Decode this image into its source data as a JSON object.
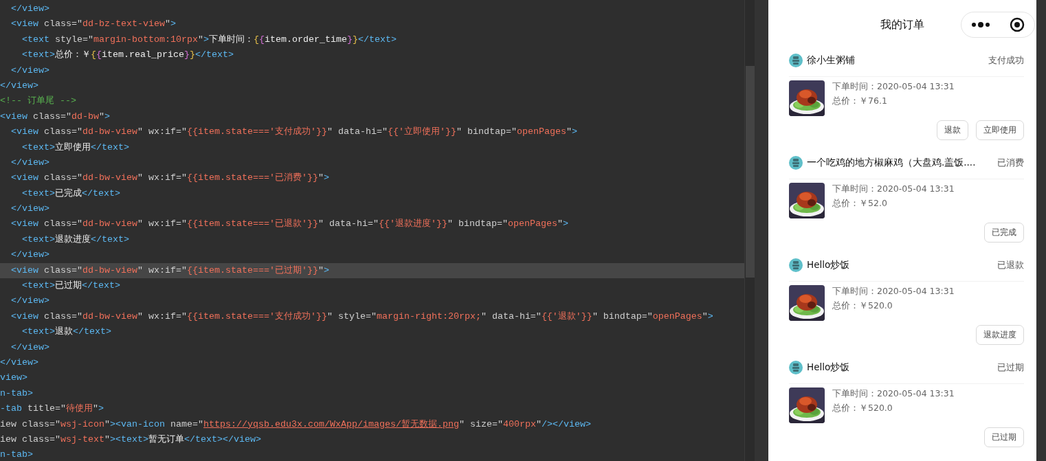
{
  "editor": {
    "lines": [
      {
        "current": false,
        "tokens": [
          {
            "kind": "tag",
            "text": "  </view>"
          }
        ]
      },
      {
        "current": false,
        "tokens": [
          {
            "kind": "tag",
            "text": "  <view"
          },
          {
            "kind": "attr",
            "text": " class=\""
          },
          {
            "kind": "str",
            "text": "dd-bz-text-view"
          },
          {
            "kind": "attr",
            "text": "\""
          },
          {
            "kind": "tag",
            "text": ">"
          }
        ]
      },
      {
        "current": false,
        "tokens": [
          {
            "kind": "tag",
            "text": "    <text"
          },
          {
            "kind": "attr",
            "text": " style=\""
          },
          {
            "kind": "str",
            "text": "margin-bottom:10rpx"
          },
          {
            "kind": "attr",
            "text": "\""
          },
          {
            "kind": "tag",
            "text": ">"
          },
          {
            "kind": "text",
            "text": "下单时间："
          },
          {
            "kind": "brace",
            "text": "{"
          },
          {
            "kind": "brace2",
            "text": "{"
          },
          {
            "kind": "text",
            "text": "item.order_time"
          },
          {
            "kind": "brace2",
            "text": "}"
          },
          {
            "kind": "brace",
            "text": "}"
          },
          {
            "kind": "tag",
            "text": "</text>"
          }
        ]
      },
      {
        "current": false,
        "tokens": [
          {
            "kind": "tag",
            "text": "    <text>"
          },
          {
            "kind": "text",
            "text": "总价：￥"
          },
          {
            "kind": "brace",
            "text": "{"
          },
          {
            "kind": "brace2",
            "text": "{"
          },
          {
            "kind": "text",
            "text": "item.real_price"
          },
          {
            "kind": "brace2",
            "text": "}"
          },
          {
            "kind": "brace",
            "text": "}"
          },
          {
            "kind": "tag",
            "text": "</text>"
          }
        ]
      },
      {
        "current": false,
        "tokens": [
          {
            "kind": "tag",
            "text": "  </view>"
          }
        ]
      },
      {
        "current": false,
        "tokens": [
          {
            "kind": "tag",
            "text": "</view>"
          }
        ]
      },
      {
        "current": false,
        "tokens": [
          {
            "kind": "comment",
            "text": "<!-- 订单尾 -->"
          }
        ]
      },
      {
        "current": false,
        "tokens": [
          {
            "kind": "tag",
            "text": "<view"
          },
          {
            "kind": "attr",
            "text": " class=\""
          },
          {
            "kind": "str",
            "text": "dd-bw"
          },
          {
            "kind": "attr",
            "text": "\""
          },
          {
            "kind": "tag",
            "text": ">"
          }
        ]
      },
      {
        "current": false,
        "tokens": [
          {
            "kind": "tag",
            "text": "  <view"
          },
          {
            "kind": "attr",
            "text": " class=\""
          },
          {
            "kind": "str",
            "text": "dd-bw-view"
          },
          {
            "kind": "attr",
            "text": "\" wx:if=\""
          },
          {
            "kind": "str",
            "text": "{{item.state==='支付成功'}}"
          },
          {
            "kind": "attr",
            "text": "\" data-hi=\""
          },
          {
            "kind": "str",
            "text": "{{'立即使用'}}"
          },
          {
            "kind": "attr",
            "text": "\" bindtap=\""
          },
          {
            "kind": "str",
            "text": "openPages"
          },
          {
            "kind": "attr",
            "text": "\""
          },
          {
            "kind": "tag",
            "text": ">"
          }
        ]
      },
      {
        "current": false,
        "tokens": [
          {
            "kind": "tag",
            "text": "    <text>"
          },
          {
            "kind": "text",
            "text": "立即使用"
          },
          {
            "kind": "tag",
            "text": "</text>"
          }
        ]
      },
      {
        "current": false,
        "tokens": [
          {
            "kind": "tag",
            "text": "  </view>"
          }
        ]
      },
      {
        "current": false,
        "tokens": [
          {
            "kind": "tag",
            "text": "  <view"
          },
          {
            "kind": "attr",
            "text": " class=\""
          },
          {
            "kind": "str",
            "text": "dd-bw-view"
          },
          {
            "kind": "attr",
            "text": "\" wx:if=\""
          },
          {
            "kind": "str",
            "text": "{{item.state==='已消费'}}"
          },
          {
            "kind": "attr",
            "text": "\""
          },
          {
            "kind": "tag",
            "text": ">"
          }
        ]
      },
      {
        "current": false,
        "tokens": [
          {
            "kind": "tag",
            "text": "    <text>"
          },
          {
            "kind": "text",
            "text": "已完成"
          },
          {
            "kind": "tag",
            "text": "</text>"
          }
        ]
      },
      {
        "current": false,
        "tokens": [
          {
            "kind": "tag",
            "text": "  </view>"
          }
        ]
      },
      {
        "current": false,
        "tokens": [
          {
            "kind": "tag",
            "text": "  <view"
          },
          {
            "kind": "attr",
            "text": " class=\""
          },
          {
            "kind": "str",
            "text": "dd-bw-view"
          },
          {
            "kind": "attr",
            "text": "\" wx:if=\""
          },
          {
            "kind": "str",
            "text": "{{item.state==='已退款'}}"
          },
          {
            "kind": "attr",
            "text": "\" data-hi=\""
          },
          {
            "kind": "str",
            "text": "{{'退款进度'}}"
          },
          {
            "kind": "attr",
            "text": "\" bindtap=\""
          },
          {
            "kind": "str",
            "text": "openPages"
          },
          {
            "kind": "attr",
            "text": "\""
          },
          {
            "kind": "tag",
            "text": ">"
          }
        ]
      },
      {
        "current": false,
        "tokens": [
          {
            "kind": "tag",
            "text": "    <text>"
          },
          {
            "kind": "text",
            "text": "退款进度"
          },
          {
            "kind": "tag",
            "text": "</text>"
          }
        ]
      },
      {
        "current": false,
        "tokens": [
          {
            "kind": "tag",
            "text": "  </view>"
          }
        ]
      },
      {
        "current": true,
        "tokens": [
          {
            "kind": "tag",
            "text": "  <view"
          },
          {
            "kind": "attr",
            "text": " class=\""
          },
          {
            "kind": "str",
            "text": "dd-bw-view"
          },
          {
            "kind": "attr",
            "text": "\" wx:if=\""
          },
          {
            "kind": "str",
            "text": "{{item.state==='已过期'}}"
          },
          {
            "kind": "attr",
            "text": "\""
          },
          {
            "kind": "tag",
            "text": ">"
          }
        ]
      },
      {
        "current": false,
        "tokens": [
          {
            "kind": "tag",
            "text": "    <text>"
          },
          {
            "kind": "text",
            "text": "已过期"
          },
          {
            "kind": "tag",
            "text": "</text>"
          }
        ]
      },
      {
        "current": false,
        "tokens": [
          {
            "kind": "tag",
            "text": "  </view>"
          }
        ]
      },
      {
        "current": false,
        "tokens": [
          {
            "kind": "tag",
            "text": "  <view"
          },
          {
            "kind": "attr",
            "text": " class=\""
          },
          {
            "kind": "str",
            "text": "dd-bw-view"
          },
          {
            "kind": "attr",
            "text": "\" wx:if=\""
          },
          {
            "kind": "str",
            "text": "{{item.state==='支付成功'}}"
          },
          {
            "kind": "attr",
            "text": "\" style=\""
          },
          {
            "kind": "str",
            "text": "margin-right:20rpx;"
          },
          {
            "kind": "attr",
            "text": "\" data-hi=\""
          },
          {
            "kind": "str",
            "text": "{{'退款'}}"
          },
          {
            "kind": "attr",
            "text": "\" bindtap=\""
          },
          {
            "kind": "str",
            "text": "openPages"
          },
          {
            "kind": "attr",
            "text": "\""
          },
          {
            "kind": "tag",
            "text": ">"
          }
        ]
      },
      {
        "current": false,
        "tokens": [
          {
            "kind": "tag",
            "text": "    <text>"
          },
          {
            "kind": "text",
            "text": "退款"
          },
          {
            "kind": "tag",
            "text": "</text>"
          }
        ]
      },
      {
        "current": false,
        "tokens": [
          {
            "kind": "tag",
            "text": "  </view>"
          }
        ]
      },
      {
        "current": false,
        "tokens": [
          {
            "kind": "tag",
            "text": "</view>"
          }
        ]
      },
      {
        "current": false,
        "tokens": [
          {
            "kind": "tag",
            "text": "view>"
          }
        ]
      },
      {
        "current": false,
        "tokens": [
          {
            "kind": "tag",
            "text": "n-tab>"
          }
        ]
      },
      {
        "current": false,
        "tokens": [
          {
            "kind": "tag",
            "text": "-tab"
          },
          {
            "kind": "attr",
            "text": " title=\""
          },
          {
            "kind": "str",
            "text": "待使用"
          },
          {
            "kind": "attr",
            "text": "\""
          },
          {
            "kind": "tag",
            "text": ">"
          }
        ]
      },
      {
        "current": false,
        "tokens": [
          {
            "kind": "attr",
            "text": "iew class=\""
          },
          {
            "kind": "str",
            "text": "wsj-icon"
          },
          {
            "kind": "attr",
            "text": "\""
          },
          {
            "kind": "tag",
            "text": "><van-icon"
          },
          {
            "kind": "attr",
            "text": " name=\""
          },
          {
            "kind": "link",
            "text": "https://yqsb.edu3x.com/WxApp/images/暂无数据.png"
          },
          {
            "kind": "attr",
            "text": "\" size=\""
          },
          {
            "kind": "str",
            "text": "400rpx"
          },
          {
            "kind": "attr",
            "text": "\""
          },
          {
            "kind": "tag",
            "text": "/></view>"
          }
        ]
      },
      {
        "current": false,
        "tokens": [
          {
            "kind": "attr",
            "text": "iew class=\""
          },
          {
            "kind": "str",
            "text": "wsj-text"
          },
          {
            "kind": "attr",
            "text": "\""
          },
          {
            "kind": "tag",
            "text": "><text>"
          },
          {
            "kind": "text",
            "text": "暂无订单"
          },
          {
            "kind": "tag",
            "text": "</text></view>"
          }
        ]
      },
      {
        "current": false,
        "tokens": [
          {
            "kind": "tag",
            "text": "n-tab>"
          }
        ]
      }
    ]
  },
  "phone": {
    "title": "我的订单",
    "orders": [
      {
        "shop": "徐小生粥铺",
        "status": "支付成功",
        "time": "下单时间：2020-05-04 13:31",
        "price": "总价：￥76.1",
        "buttons": [
          "退款",
          "立即使用"
        ]
      },
      {
        "shop": "一个吃鸡的地方椒麻鸡（大盘鸡.盖饭....",
        "status": "已消费",
        "time": "下单时间：2020-05-04 13:31",
        "price": "总价：￥52.0",
        "buttons": [
          "已完成"
        ]
      },
      {
        "shop": "Hello炒饭",
        "status": "已退款",
        "time": "下单时间：2020-05-04 13:31",
        "price": "总价：￥520.0",
        "buttons": [
          "退款进度"
        ]
      },
      {
        "shop": "Hello炒饭",
        "status": "已过期",
        "time": "下单时间：2020-05-04 13:31",
        "price": "总价：￥520.0",
        "buttons": [
          "已过期"
        ]
      }
    ]
  }
}
